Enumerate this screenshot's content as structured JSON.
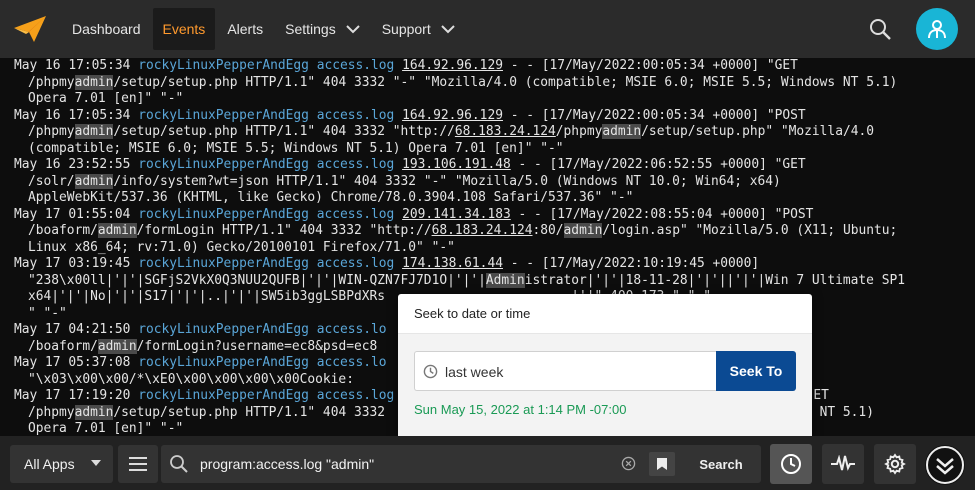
{
  "nav": {
    "items": [
      {
        "label": "Dashboard",
        "active": false
      },
      {
        "label": "Events",
        "active": true
      },
      {
        "label": "Alerts",
        "active": false
      },
      {
        "label": "Settings",
        "active": false
      },
      {
        "label": "Support",
        "active": false
      }
    ]
  },
  "colors": {
    "accent": "#ff9a2e",
    "host": "#5aa6d8",
    "avatar": "#19b5d6",
    "seek_button": "#0b4a93",
    "seek_result": "#1a9a55"
  },
  "log": {
    "lines": [
      [
        {
          "t": "May 16 17:05:34 "
        },
        {
          "t": "rockyLinuxPepperAndEgg",
          "c": "host"
        },
        {
          "t": " "
        },
        {
          "t": "access.log",
          "c": "host"
        },
        {
          "t": " "
        },
        {
          "t": "164.92.96.129",
          "c": "ip"
        },
        {
          "t": " - - [17/May/2022:00:05:34 +0000] \"GET"
        }
      ],
      [
        {
          "t": "/phpmy",
          "cont": true
        },
        {
          "t": "admin",
          "c": "hl"
        },
        {
          "t": "/setup/setup.php HTTP/1.1\" 404 3332 \"-\" \"Mozilla/4.0 (compatible; MSIE 6.0; MSIE 5.5; Windows NT 5.1)"
        }
      ],
      [
        {
          "t": "Opera 7.01 [en]\" \"-\"",
          "cont": true
        }
      ],
      [
        {
          "t": "May 16 17:05:34 "
        },
        {
          "t": "rockyLinuxPepperAndEgg",
          "c": "host"
        },
        {
          "t": " "
        },
        {
          "t": "access.log",
          "c": "host"
        },
        {
          "t": " "
        },
        {
          "t": "164.92.96.129",
          "c": "ip"
        },
        {
          "t": " - - [17/May/2022:00:05:34 +0000] \"POST"
        }
      ],
      [
        {
          "t": "/phpmy",
          "cont": true
        },
        {
          "t": "admin",
          "c": "hl"
        },
        {
          "t": "/setup/setup.php HTTP/1.1\" 404 3332 \"http://"
        },
        {
          "t": "68.183.24.124",
          "c": "ip"
        },
        {
          "t": "/phpmy"
        },
        {
          "t": "admin",
          "c": "hl"
        },
        {
          "t": "/setup/setup.php\" \"Mozilla/4.0"
        }
      ],
      [
        {
          "t": "(compatible; MSIE 6.0; MSIE 5.5; Windows NT 5.1) Opera 7.01 [en]\" \"-\"",
          "cont": true
        }
      ],
      [
        {
          "t": "May 16 23:52:55 "
        },
        {
          "t": "rockyLinuxPepperAndEgg",
          "c": "host"
        },
        {
          "t": " "
        },
        {
          "t": "access.log",
          "c": "host"
        },
        {
          "t": " "
        },
        {
          "t": "193.106.191.48",
          "c": "ip"
        },
        {
          "t": " - - [17/May/2022:06:52:55 +0000] \"GET"
        }
      ],
      [
        {
          "t": "/solr/",
          "cont": true
        },
        {
          "t": "admin",
          "c": "hl"
        },
        {
          "t": "/info/system?wt=json HTTP/1.1\" 404 3332 \"-\" \"Mozilla/5.0 (Windows NT 10.0; Win64; x64)"
        }
      ],
      [
        {
          "t": "AppleWebKit/537.36 (KHTML, like Gecko) Chrome/78.0.3904.108 Safari/537.36\" \"-\"",
          "cont": true
        }
      ],
      [
        {
          "t": "May 17 01:55:04 "
        },
        {
          "t": "rockyLinuxPepperAndEgg",
          "c": "host"
        },
        {
          "t": " "
        },
        {
          "t": "access.log",
          "c": "host"
        },
        {
          "t": " "
        },
        {
          "t": "209.141.34.183",
          "c": "ip"
        },
        {
          "t": " - - [17/May/2022:08:55:04 +0000] \"POST"
        }
      ],
      [
        {
          "t": "/boaform/",
          "cont": true
        },
        {
          "t": "admin",
          "c": "hl"
        },
        {
          "t": "/formLogin HTTP/1.1\" 404 3332 \"http://"
        },
        {
          "t": "68.183.24.124",
          "c": "ip"
        },
        {
          "t": ":80/"
        },
        {
          "t": "admin",
          "c": "hl"
        },
        {
          "t": "/login.asp\" \"Mozilla/5.0 (X11; Ubuntu;"
        }
      ],
      [
        {
          "t": "Linux x86_64; rv:71.0) Gecko/20100101 Firefox/71.0\" \"-\"",
          "cont": true
        }
      ],
      [
        {
          "t": "May 17 03:19:45 "
        },
        {
          "t": "rockyLinuxPepperAndEgg",
          "c": "host"
        },
        {
          "t": " "
        },
        {
          "t": "access.log",
          "c": "host"
        },
        {
          "t": " "
        },
        {
          "t": "174.138.61.44",
          "c": "ip"
        },
        {
          "t": " - - [17/May/2022:10:19:45 +0000]"
        }
      ],
      [
        {
          "t": "\"238\\x00ll|'|'|SGFjS2VkX0Q3NUU2QUFB|'|'|WIN-QZN7FJ7D1O|'|'|",
          "cont": true
        },
        {
          "t": "Admin",
          "c": "hl"
        },
        {
          "t": "istrator|'|'|18-11-28|'|'||'|'|Win 7 Ultimate SP1"
        }
      ],
      [
        {
          "t": "x64|'|'|No|'|'|S17|'|'|..|'|'|SW5ib3ggLSBPdXRs                        |'|\" 400 173 \"-\" \"-",
          "cont": true
        }
      ],
      [
        {
          "t": "\" \"-\"",
          "cont": true
        }
      ],
      [
        {
          "t": "May 17 04:21:50 "
        },
        {
          "t": "rockyLinuxPepperAndEgg",
          "c": "host"
        },
        {
          "t": " "
        },
        {
          "t": "access.lo",
          "c": "host"
        },
        {
          "t": "                                                 T"
        }
      ],
      [
        {
          "t": "/boaform/",
          "cont": true
        },
        {
          "t": "admin",
          "c": "hl"
        },
        {
          "t": "/formLogin?username=ec8&psd=ec8"
        }
      ],
      [
        {
          "t": "May 17 05:37:08 "
        },
        {
          "t": "rockyLinuxPepperAndEgg",
          "c": "host"
        },
        {
          "t": " "
        },
        {
          "t": "access.lo",
          "c": "host"
        }
      ],
      [
        {
          "t": "\"\\x03\\x00\\x00/*\\xE0\\x00\\x00\\x00\\x00Cookie:",
          "cont": true
        }
      ],
      [
        {
          "t": "May 17 17:19:20 "
        },
        {
          "t": "rockyLinuxPepperAndEgg",
          "c": "host"
        },
        {
          "t": " "
        },
        {
          "t": "access.log",
          "c": "host"
        },
        {
          "t": " 3332                                                 ET"
        }
      ],
      [
        {
          "t": "/phpmy",
          "cont": true
        },
        {
          "t": "admin",
          "c": "hl"
        },
        {
          "t": "/setup/setup.php HTTP/1.1\" 404 3332                                                 indows NT 5.1)"
        }
      ],
      [
        {
          "t": "Opera 7.01 [en]\" \"-\"",
          "cont": true
        }
      ]
    ]
  },
  "bottom": {
    "all_apps_label": "All Apps",
    "search_query": "program:access.log \"admin\"",
    "search_button": "Search"
  },
  "seek": {
    "title": "Seek to date or time",
    "input_value": "last week",
    "button_label": "Seek To",
    "result": "Sun May 15, 2022 at 1:14 PM -07:00"
  }
}
